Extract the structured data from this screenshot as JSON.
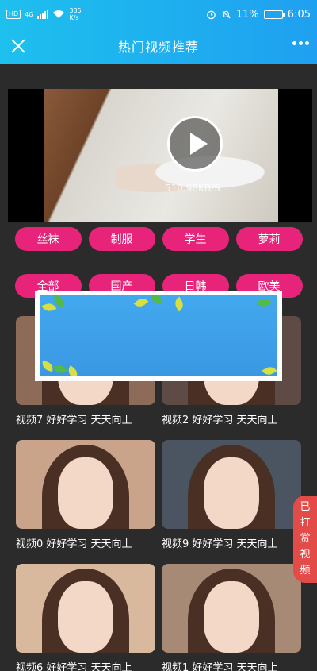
{
  "status_bar": {
    "hd": "HD",
    "network": "4G",
    "speed_value": "335",
    "speed_unit": "K/s",
    "battery_percent": "11%",
    "battery_level": 0.11,
    "time": "6:05",
    "icons": [
      "alarm-icon",
      "mute-icon",
      "battery-icon",
      "wifi-icon",
      "signal-icon"
    ]
  },
  "header": {
    "title": "热门视频推荐",
    "close_icon": "close-icon",
    "more_icon": "more-icon"
  },
  "player": {
    "load_speed": "510.98KB/S",
    "play_icon": "play-icon"
  },
  "tags_row1": [
    "丝袜",
    "制服",
    "学生",
    "萝莉"
  ],
  "tags_row2": [
    "全部",
    "国产",
    "日韩",
    "欧美"
  ],
  "videos": [
    {
      "title": "视频7 好好学习 天天向上",
      "bg": "#8c6b58"
    },
    {
      "title": "视频2 好好学习 天天向上",
      "bg": "#5e4b45"
    },
    {
      "title": "视频0 好好学习 天天向上",
      "bg": "#c9a48a"
    },
    {
      "title": "视频9 好好学习 天天向上",
      "bg": "#4b5561"
    },
    {
      "title": "视频6 好好学习 天天向上",
      "bg": "#d9b99d"
    },
    {
      "title": "视频1 好好学习 天天向上",
      "bg": "#a78a76"
    }
  ],
  "reward_tab": {
    "chars": [
      "已",
      "打",
      "赏",
      "视",
      "频"
    ]
  },
  "colors": {
    "header_gradient_start": "#1ec0ee",
    "header_gradient_end": "#1fa0f0",
    "tag": "#e8247a",
    "background": "#2b2b2b",
    "reward_tab": "#e24b48"
  }
}
